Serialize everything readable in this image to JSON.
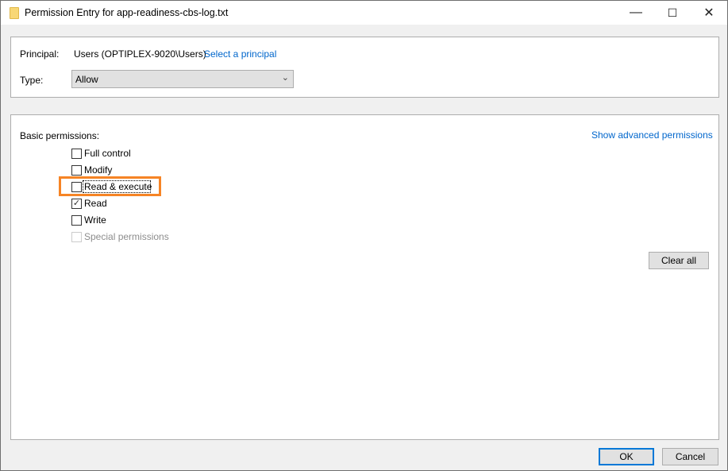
{
  "window": {
    "title": "Permission Entry for app-readiness-cbs-log.txt",
    "minimize": "—",
    "maximize": "☐",
    "close": "✕"
  },
  "principal": {
    "label": "Principal:",
    "value": "Users (OPTIPLEX-9020\\Users)",
    "link": "Select a principal"
  },
  "type": {
    "label": "Type:",
    "value": "Allow"
  },
  "permissions": {
    "label": "Basic permissions:",
    "advanced_link": "Show advanced permissions",
    "items": [
      {
        "label": "Full control",
        "checked": false,
        "disabled": false
      },
      {
        "label": "Modify",
        "checked": false,
        "disabled": false
      },
      {
        "label": "Read & execute",
        "checked": false,
        "disabled": false
      },
      {
        "label": "Read",
        "checked": true,
        "disabled": false
      },
      {
        "label": "Write",
        "checked": false,
        "disabled": false
      },
      {
        "label": "Special permissions",
        "checked": false,
        "disabled": true
      }
    ],
    "clear_all": "Clear all"
  },
  "footer": {
    "ok": "OK",
    "cancel": "Cancel"
  },
  "colors": {
    "highlight": "#f68425",
    "link": "#0066cc",
    "default_button": "#0078d7"
  }
}
